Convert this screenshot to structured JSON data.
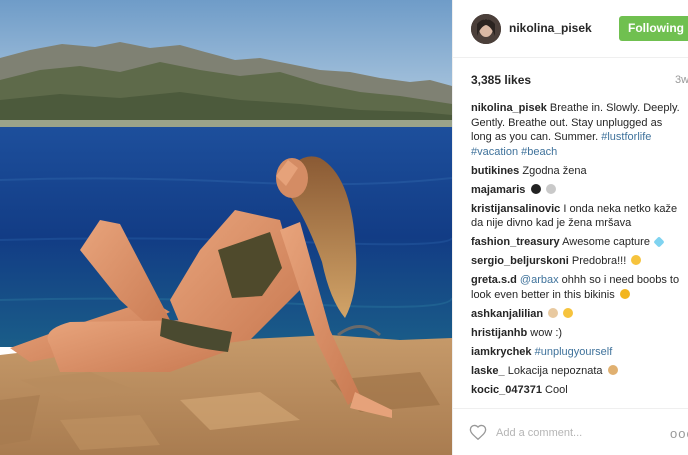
{
  "header": {
    "username": "nikolina_pisek",
    "follow_label": "Following"
  },
  "post": {
    "likes": "3,385 likes",
    "time": "3w"
  },
  "comments": [
    {
      "user": "nikolina_pisek",
      "text": "Breathe in. Slowly. Deeply. Gently. Breathe out. Stay unplugged as long as you can. Summer.",
      "tags": [
        "#lustforlife",
        "#vacation",
        "#beach"
      ]
    },
    {
      "user": "butikines",
      "text": "Zgodna žena"
    },
    {
      "user": "majamaris",
      "text": "",
      "emojis": [
        "bomb-emoji",
        "clap-emoji"
      ]
    },
    {
      "user": "kristijansalinovic",
      "text": "I onda neka netko kaže da nije divno kad je žena mršava"
    },
    {
      "user": "fashion_treasury",
      "text": "Awesome capture",
      "emojis": [
        "gem-emoji"
      ]
    },
    {
      "user": "sergio_beljurskoni",
      "text": "Predobra!!!",
      "emojis": [
        "grin-emoji"
      ]
    },
    {
      "user": "greta.s.d",
      "mention": "@arbax",
      "text": "ohhh so i need boobs to look even better in this bikinis",
      "emojis": [
        "laugh-emoji"
      ]
    },
    {
      "user": "ashkanjalilian",
      "text": "",
      "emojis": [
        "ok-hand-emoji",
        "wow-emoji"
      ]
    },
    {
      "user": "hristijanhb",
      "text": "wow :)"
    },
    {
      "user": "iamkrychek",
      "tag": "#unplugyourself"
    },
    {
      "user": "laske_",
      "text": "Lokacija nepoznata",
      "emojis": [
        "scream-emoji"
      ]
    },
    {
      "user": "kocic_047371",
      "text": "Cool"
    }
  ],
  "add_comment": {
    "placeholder": "Add a comment...",
    "more_label": "ooo"
  },
  "colors": {
    "follow_green": "#70c050",
    "link_blue": "#3f729b",
    "sea": "#123c8a",
    "sky": "#8fb5d8"
  }
}
